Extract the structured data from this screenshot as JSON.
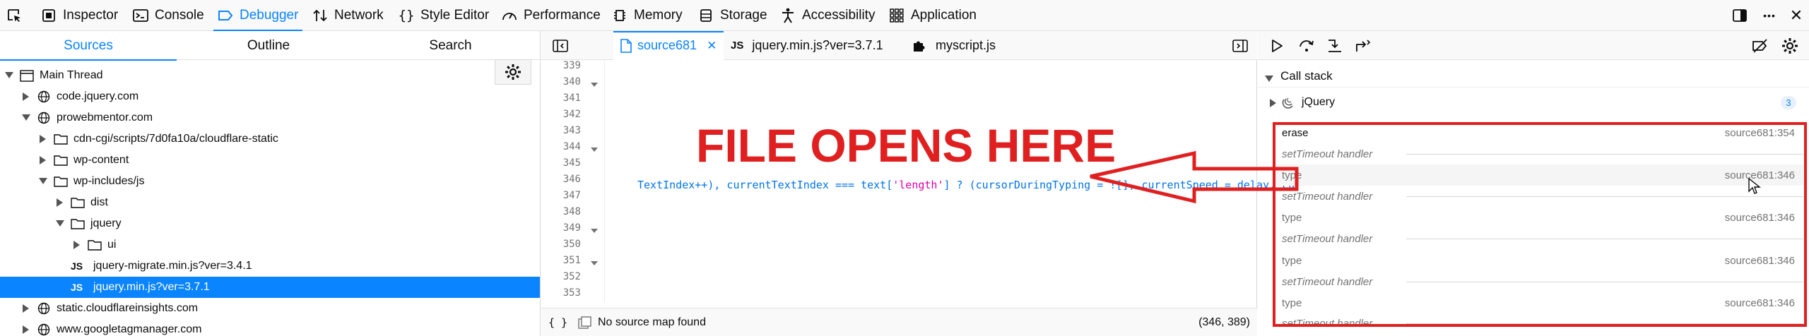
{
  "toolbox": {
    "tabs": [
      {
        "label": "Inspector"
      },
      {
        "label": "Console"
      },
      {
        "label": "Debugger"
      },
      {
        "label": "Network"
      },
      {
        "label": "Style Editor"
      },
      {
        "label": "Performance"
      },
      {
        "label": "Memory"
      },
      {
        "label": "Storage"
      },
      {
        "label": "Accessibility"
      },
      {
        "label": "Application"
      }
    ],
    "selected": "Debugger",
    "more_label": "•••",
    "close_label": "✕"
  },
  "sources_pane": {
    "tabs": [
      {
        "label": "Sources"
      },
      {
        "label": "Outline"
      },
      {
        "label": "Search"
      }
    ],
    "active_tab": "Sources",
    "tree": [
      {
        "label": "Main Thread"
      },
      {
        "label": "code.jquery.com"
      },
      {
        "label": "prowebmentor.com"
      },
      {
        "label": "cdn-cgi/scripts/7d0fa10a/cloudflare-static"
      },
      {
        "label": "wp-content"
      },
      {
        "label": "wp-includes/js"
      },
      {
        "label": "dist"
      },
      {
        "label": "jquery"
      },
      {
        "label": "ui"
      },
      {
        "label": "jquery-migrate.min.js?ver=3.4.1",
        "badge": "JS"
      },
      {
        "label": "jquery.min.js?ver=3.7.1",
        "badge": "JS"
      },
      {
        "label": "static.cloudflareinsights.com"
      },
      {
        "label": "www.googletagmanager.com"
      }
    ],
    "selected_item": "jquery.min.js?ver=3.7.1"
  },
  "editor": {
    "tabs": [
      {
        "label": "source681"
      },
      {
        "label": "jquery.min.js?ver=3.7.1",
        "badge": "JS"
      },
      {
        "label": "myscript.js"
      }
    ],
    "active_tab": "source681",
    "close_label": "✕",
    "line_numbers": [
      "339",
      "340",
      "341",
      "342",
      "343",
      "344",
      "345",
      "346",
      "347",
      "348",
      "349",
      "350",
      "351",
      "352",
      "353"
    ],
    "code_346": {
      "part1": "TextIndex++), currentTextIndex === text[",
      "string": "'length'",
      "part2": "] ? (cursorDuringTyping = ![], currentSpeed = delay, cu"
    },
    "footer": {
      "braces_label": "{ }",
      "source_map_text": "No source map found",
      "cursor_position": "(346, 389)"
    }
  },
  "debugger": {
    "call_stack": {
      "title": "Call stack",
      "group_label": "jQuery",
      "group_count": "3",
      "frames": [
        {
          "name": "erase",
          "location": "source681:354"
        },
        {
          "async": "setTimeout handler"
        },
        {
          "name": "type",
          "location": "source681:346"
        },
        {
          "async": "setTimeout handler"
        },
        {
          "name": "type",
          "location": "source681:346"
        },
        {
          "async": "setTimeout handler"
        },
        {
          "name": "type",
          "location": "source681:346"
        },
        {
          "async": "setTimeout handler"
        },
        {
          "name": "type",
          "location": "source681:346"
        },
        {
          "async": "setTimeout handler"
        }
      ]
    }
  },
  "annotation": {
    "text": "FILE OPENS HERE",
    "color": "#e02020"
  },
  "colors": {
    "accent": "#0a84ff",
    "annotation_red": "#e02020"
  }
}
